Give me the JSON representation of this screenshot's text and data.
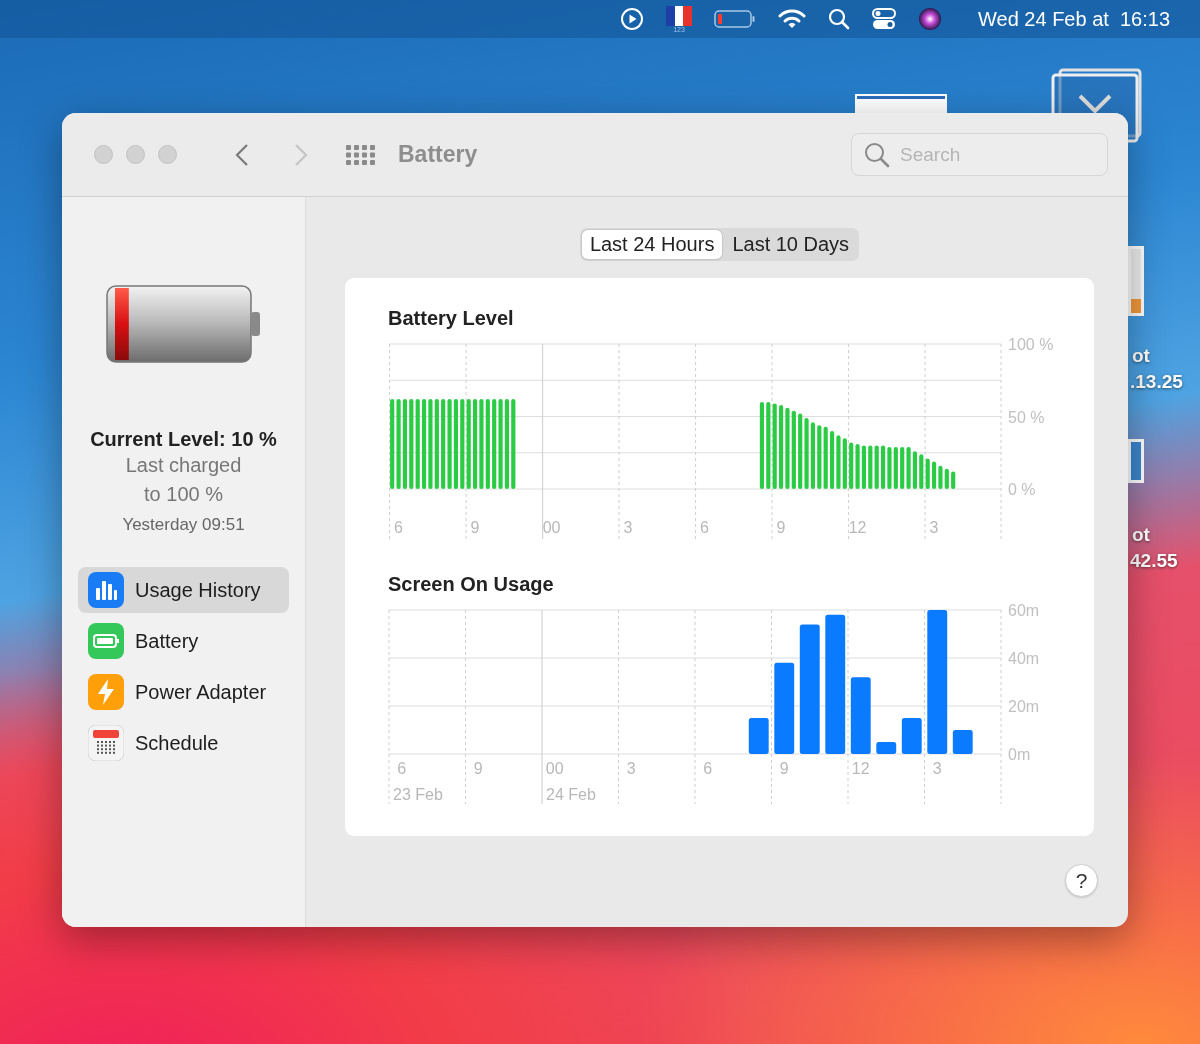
{
  "menu_bar": {
    "input_source_label": "123",
    "clock": "Wed 24 Feb at  16:13"
  },
  "desktop_items": [
    {
      "label_lines": [
        "ot",
        ".13.25"
      ]
    },
    {
      "label_lines": [
        "ot",
        "42.55"
      ]
    }
  ],
  "window": {
    "title": "Battery",
    "search": {
      "placeholder": "Search"
    }
  },
  "sidebar": {
    "battery_icon": {
      "level": 0.1
    },
    "current_level": "Current Level: 10 %",
    "last_charged_lines": [
      "Last charged",
      "to 100 %"
    ],
    "last_charged_time": "Yesterday 09:51",
    "items": [
      {
        "label": "Usage History",
        "kind": "usage",
        "selected": true
      },
      {
        "label": "Battery",
        "kind": "battery",
        "selected": false
      },
      {
        "label": "Power Adapter",
        "kind": "power",
        "selected": false
      },
      {
        "label": "Schedule",
        "kind": "schedule",
        "selected": false
      }
    ]
  },
  "segments": [
    {
      "label": "Last 24 Hours",
      "selected": true
    },
    {
      "label": "Last 10 Days",
      "selected": false
    }
  ],
  "charts": [
    {
      "chart_data": {
        "title": "Battery Level",
        "type": "bar",
        "categories": [
          null,
          "6",
          null,
          null,
          null,
          null,
          null,
          null,
          null,
          null,
          null,
          null,
          null,
          "9",
          null,
          null,
          null,
          null,
          null,
          null,
          null,
          null,
          null,
          null,
          null,
          "00",
          null,
          null,
          null,
          null,
          null,
          null,
          null,
          null,
          null,
          null,
          null,
          "3",
          null,
          null,
          null,
          null,
          null,
          null,
          null,
          null,
          null,
          null,
          null,
          "6",
          null,
          null,
          null,
          null,
          null,
          null,
          null,
          null,
          null,
          null,
          null,
          "9",
          null,
          null,
          null,
          null,
          null,
          null,
          null,
          null,
          null,
          null,
          null,
          "12",
          null,
          null,
          null,
          null,
          null,
          null,
          null,
          null,
          null,
          null,
          null,
          "3",
          null,
          null,
          null,
          null,
          null,
          null,
          null,
          null,
          null,
          null
        ],
        "series": [
          {
            "color": "#2bcb45",
            "values": [
              62,
              62,
              62,
              62,
              62,
              62,
              62,
              62,
              62,
              62,
              62,
              62,
              62,
              62,
              62,
              62,
              62,
              62,
              62,
              62,
              null,
              null,
              null,
              null,
              null,
              null,
              null,
              null,
              null,
              null,
              null,
              null,
              null,
              null,
              null,
              null,
              null,
              null,
              null,
              null,
              null,
              null,
              null,
              null,
              null,
              null,
              null,
              null,
              null,
              null,
              null,
              null,
              null,
              null,
              null,
              null,
              null,
              null,
              60,
              60,
              59,
              58,
              56,
              54,
              52,
              49,
              46,
              44,
              43,
              40,
              37,
              35,
              32,
              31,
              30,
              30,
              30,
              30,
              29,
              29,
              29,
              29,
              26,
              24,
              21,
              19,
              16,
              14,
              12,
              null,
              null,
              null,
              null,
              null,
              null,
              null
            ]
          }
        ],
        "ylim": [
          0,
          100
        ],
        "yticks": [
          {
            "value": 0,
            "label": "0 %"
          },
          {
            "value": 50,
            "label": "50 %"
          },
          {
            "value": 100,
            "label": "100 %"
          }
        ]
      }
    },
    {
      "chart_data": {
        "title": "Screen On Usage",
        "type": "bar",
        "categories": [
          "6",
          null,
          null,
          "9",
          null,
          null,
          "00",
          null,
          null,
          "3",
          null,
          null,
          "6",
          null,
          null,
          "9",
          null,
          null,
          "12",
          null,
          null,
          "3",
          null,
          null
        ],
        "series": [
          {
            "color": "#0a7aff",
            "values": [
              null,
              null,
              null,
              null,
              null,
              null,
              null,
              null,
              null,
              null,
              null,
              null,
              null,
              null,
              15,
              38,
              54,
              58,
              32,
              5,
              15,
              60,
              10,
              null
            ]
          }
        ],
        "ylim": [
          0,
          60
        ],
        "yticks": [
          {
            "value": 0,
            "label": "0m"
          },
          {
            "value": 20,
            "label": "20m"
          },
          {
            "value": 40,
            "label": "40m"
          },
          {
            "value": 60,
            "label": "60m"
          }
        ],
        "annotations": [
          "23 Feb",
          "24 Feb"
        ]
      }
    }
  ],
  "help": "?"
}
